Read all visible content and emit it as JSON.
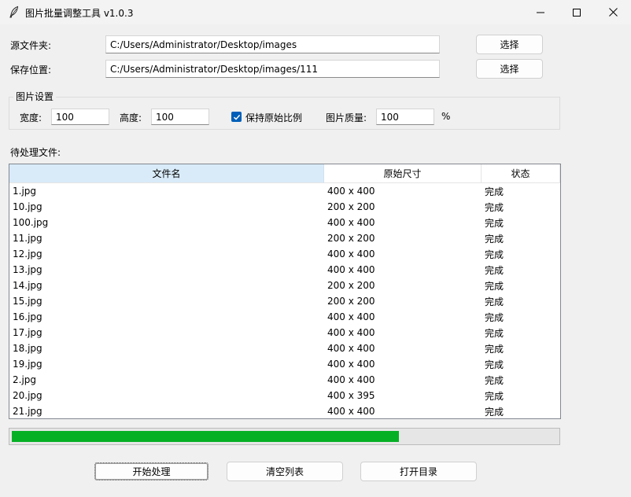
{
  "window": {
    "title": "图片批量调整工具 v1.0.3",
    "icon": "feather-icon"
  },
  "source": {
    "label": "源文件夹:",
    "value": "C:/Users/Administrator/Desktop/images",
    "button": "选择"
  },
  "save": {
    "label": "保存位置:",
    "value": "C:/Users/Administrator/Desktop/images/111",
    "button": "选择"
  },
  "settings": {
    "title": "图片设置",
    "width_label": "宽度:",
    "width_value": "100",
    "height_label": "高度:",
    "height_value": "100",
    "keep_ratio_label": "保持原始比例",
    "keep_ratio_checked": true,
    "quality_label": "图片质量:",
    "quality_value": "100",
    "quality_unit": "%"
  },
  "files": {
    "label": "待处理文件:",
    "columns": [
      "文件名",
      "原始尺寸",
      "状态"
    ],
    "rows": [
      [
        "1.jpg",
        "400 x 400",
        "完成"
      ],
      [
        "10.jpg",
        "200 x 200",
        "完成"
      ],
      [
        "100.jpg",
        "400 x 400",
        "完成"
      ],
      [
        "11.jpg",
        "200 x 200",
        "完成"
      ],
      [
        "12.jpg",
        "400 x 400",
        "完成"
      ],
      [
        "13.jpg",
        "400 x 400",
        "完成"
      ],
      [
        "14.jpg",
        "200 x 200",
        "完成"
      ],
      [
        "15.jpg",
        "200 x 200",
        "完成"
      ],
      [
        "16.jpg",
        "400 x 400",
        "完成"
      ],
      [
        "17.jpg",
        "400 x 400",
        "完成"
      ],
      [
        "18.jpg",
        "400 x 400",
        "完成"
      ],
      [
        "19.jpg",
        "400 x 400",
        "完成"
      ],
      [
        "2.jpg",
        "400 x 400",
        "完成"
      ],
      [
        "20.jpg",
        "400 x 395",
        "完成"
      ],
      [
        "21.jpg",
        "400 x 400",
        "完成"
      ]
    ]
  },
  "progress": {
    "fraction": 0.71
  },
  "actions": {
    "start": "开始处理",
    "clear": "清空列表",
    "open_dir": "打开目录"
  },
  "colors": {
    "progress_fill": "#06b025",
    "checkbox": "#005fb8",
    "header_active": "#d9ebf9"
  }
}
